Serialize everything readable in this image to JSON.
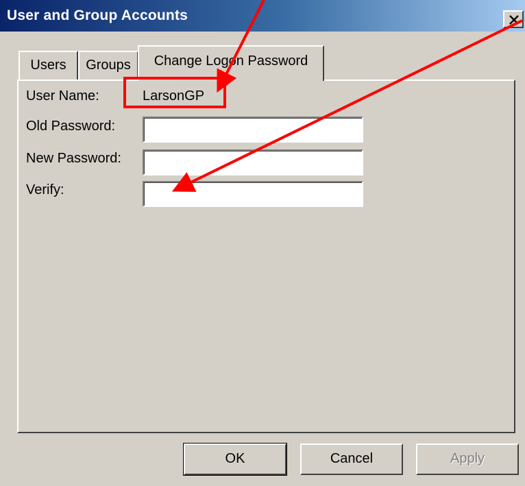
{
  "window": {
    "title": "User and Group Accounts",
    "close_symbol": "x"
  },
  "tabs": [
    {
      "label": "Users",
      "active": false
    },
    {
      "label": "Groups",
      "active": false
    },
    {
      "label": "Change Logon Password",
      "active": true
    }
  ],
  "form": {
    "user_name_label": "User Name:",
    "user_name_value": "LarsonGP",
    "old_password_label": "Old Password:",
    "old_password_value": "",
    "new_password_label": "New Password:",
    "new_password_value": "",
    "verify_label": "Verify:",
    "verify_value": ""
  },
  "buttons": {
    "ok": "OK",
    "cancel": "Cancel",
    "apply": "Apply"
  },
  "annotation_colors": {
    "arrow": "#ff0000",
    "highlight_box": "#ff0000"
  }
}
